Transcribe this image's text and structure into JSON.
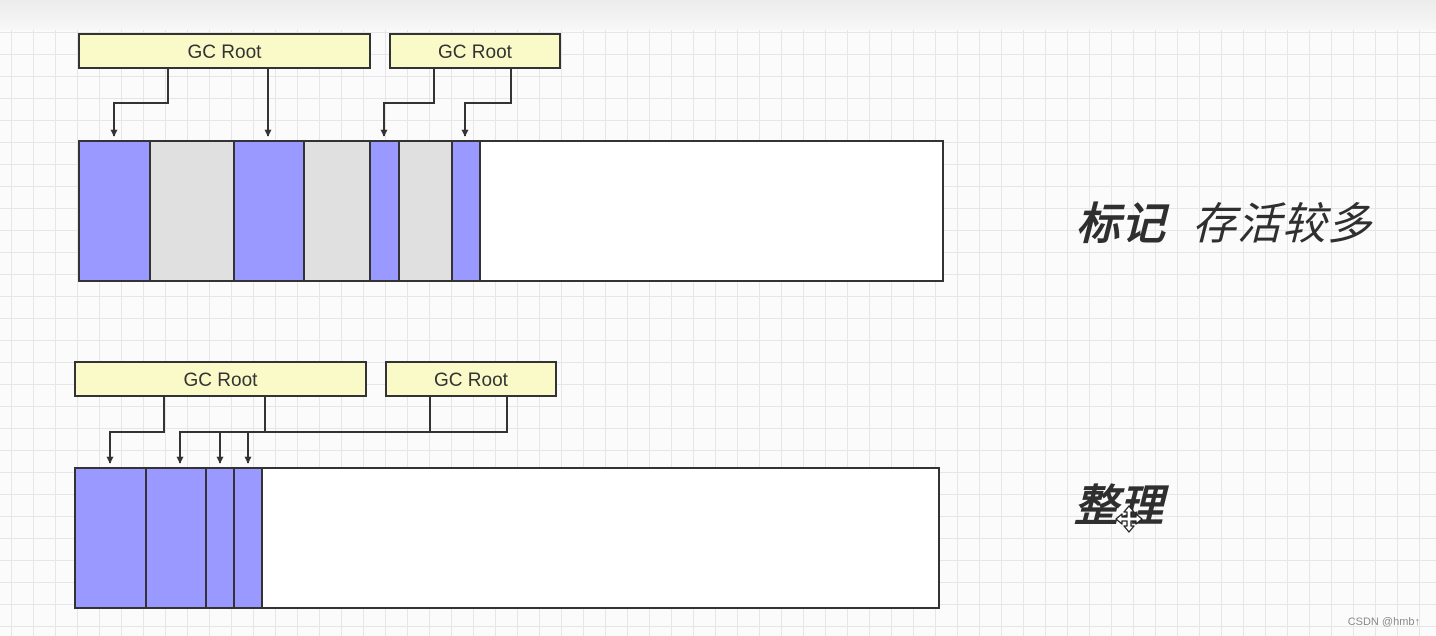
{
  "labels": {
    "gc_root": "GC Root"
  },
  "captions": {
    "mark_bold": "标记",
    "mark_normal": "存活较多",
    "compact_bold": "整理"
  },
  "watermark": "CSDN @hmb↑",
  "colors": {
    "alive": "#9999ff",
    "garbage": "#e0e0e0",
    "free": "#ffffff",
    "root_fill": "#fafac8",
    "stroke": "#333333"
  },
  "icons": {
    "cursor": "move-cursor-icon"
  }
}
